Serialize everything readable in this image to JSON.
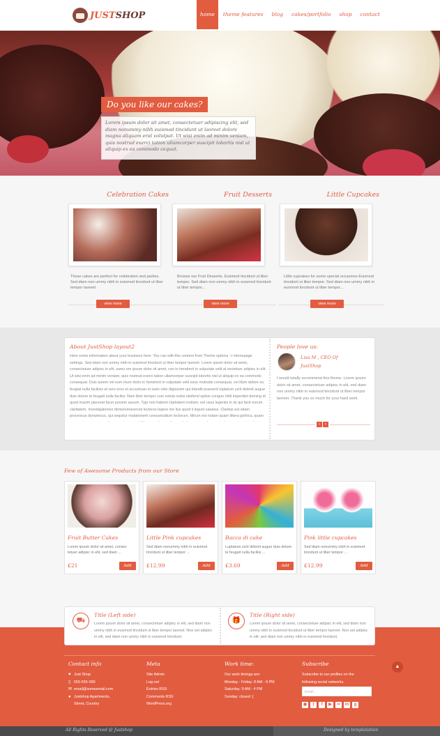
{
  "header": {
    "logo_just": "JUST",
    "logo_shop": "SHOP",
    "nav": [
      "home",
      "theme features",
      "blog",
      "cakes/portfolio",
      "shop",
      "contact"
    ],
    "active_nav": "home"
  },
  "hero": {
    "title": "Do you like our cakes?",
    "text": "Lorem ipsum dolor sit amet, consectetuer adipiscing elit, sed diam nonummy nibh euismod tincidunt ut laoreet dolore magna aliquam erat volutpat. Ut wisi enim ad minim veniam, quis nostrud exerci tation ullamcorper suscipit lobortis nisl ut aliquip ex ea commodo cequat."
  },
  "features": [
    {
      "title": "Celebration Cakes",
      "desc": "These cakes are perfect for celebration and parties. Sed diam non ummy nibh in euismod tincidunt ut liber tempor laoreet.",
      "button": "view more"
    },
    {
      "title": "Fruit Desserts",
      "desc": "Browse our Fruit Desserts. Euismod tincidunt ut liber tempor. Sed diam non ummy nibh in euismod tincidunt ut liber tempor...",
      "button": "view more"
    },
    {
      "title": "Little Cupcakes",
      "desc": "Little cupcakes for some special occasions Euismod tincidunt ut liber tempor. Sed diam non ummy nibh in euismod tincidunt ut liber tempor...",
      "button": "view more"
    }
  ],
  "about": {
    "title": "About JustShop layout2",
    "text": "Here some information about your business here. You can edit this content from Theme options -> Homepage settings. Sed diam non ummy nibh in euismod tincidunt ut liber tempor laoreet. Lorem ipsum dolor sit amet, consectetuer adipisc in elit, samo em ipsum dolor sit amet, con in hendrerit in vulputate velit at sectetuer adipisc in elit. Ut wisi enim ad minim veniam, quis nostrud exerci tation ullamcorper suscipit lobortis nisl ut aliquip ex ea commodo consequat. Duis autem vel eum iriure dolor in hendrerit in vulputate velit esse molestie consequat, vel illum dolore eu feugiat nulla facilisis at vero eros et accumsan et iusto odio dignissim qui blandit praesent luptatum zzril delenit augue duis dolore te feugait nulla facilisi. Nam liber tempor cum soluta nobis eleifend option congue nihil imperdiet doming id quod mazim placerat facer possim assum. Typi non habent claritatem insitam; est usus legentis in iis qui facit eorum claritatem. Investigationes demonstraverunt lectores legere me lius quod ii legunt saepius. Claritas est etiam processus dynamicus, qui sequitur mutationem consuetudium lectorum. Mirum est notare quam littera gothica, quam nunc putamus parum claram, anteposuerit litterarum formas humanitatis per seacula quarta decima et quinta decima."
  },
  "testimonial": {
    "title": "People love us:",
    "name": "Lisa M , CEO Of JustShop",
    "quote": "I would totally recommend this theme. Lorem ipsum dolor sit amet, consectetuer adipisc in elit, sed diam non ummy nibh in euismod tincidunt ut liber tempor laoreet. Thank you so much for your hard work"
  },
  "products": {
    "title": "Few of Awesome Products from our Store",
    "items": [
      {
        "name": "Fruit Butter Cakes",
        "desc": "Lorem ipsum dolor sit amet, consec tetuer adipisc in elit, sed diam ...",
        "price": "£21",
        "button": "Add"
      },
      {
        "name": "Little Pink cupcakes",
        "desc": "Sed diam nonummy nibh in euismod tincidunt ut liber tempor ...",
        "price": "£12.99",
        "button": "Add"
      },
      {
        "name": "Bacca di cake",
        "desc": "Luptatum zzril delenit augue duis dolore te feugait nulla facilisi ...",
        "price": "£3.69",
        "button": "Add"
      },
      {
        "name": "Pink little cupcakes",
        "desc": "Sed diam nonummy nibh in euismod tincidunt ut liber tempor ...",
        "price": "£12.99",
        "button": "Add"
      }
    ]
  },
  "titles": {
    "left_title": "Title (Left side)",
    "left_text": "Lorem ipsum dolor sit amet, consectetuer adipisc in elit, sed diam non ummy nibh in euismod tincidunt ut liber tempor laoreet. Non set adipisc in elit, sed diam non ummy nibh in euismod tincidunt.",
    "right_title": "Title (Right side)",
    "right_text": "Lorem ipsum dolor sit amet, consectetuer adipisc in elit, sed diam non ummy nibh in euismod tincidunt ut liber tempor laoreet. Non set adipisc in elit, sed diam non ummy nibh in euismod tincidunt."
  },
  "footer": {
    "contact": {
      "title": "Contact info",
      "name": "Just Shop",
      "phone": "555-555-000",
      "email": "email@someemail.com",
      "address1": "Justshop Apartments,",
      "address2": "Street, Country"
    },
    "meta": {
      "title": "Meta",
      "items": [
        "Site Admin",
        "Log out",
        "Entries RSS",
        "Comments RSS",
        "WordPress.org"
      ]
    },
    "work": {
      "title": "Work time:",
      "items": [
        "Our work timings are:",
        "Monday - Friday: 8 AM - 9 PM",
        "Saturday: 9 AM - 4 PM",
        "Sunday: closed :("
      ]
    },
    "subscribe": {
      "title": "Subscribe",
      "text1": "Subscribe to our profiles on the",
      "text2": "following social networks.",
      "placeholder": "Email..."
    },
    "copyright": "All Rights Reserved @ Justshop",
    "credit": "Designed by templatation"
  },
  "colors": {
    "accent": "#e25c40",
    "dark": "#4a4a4a"
  }
}
